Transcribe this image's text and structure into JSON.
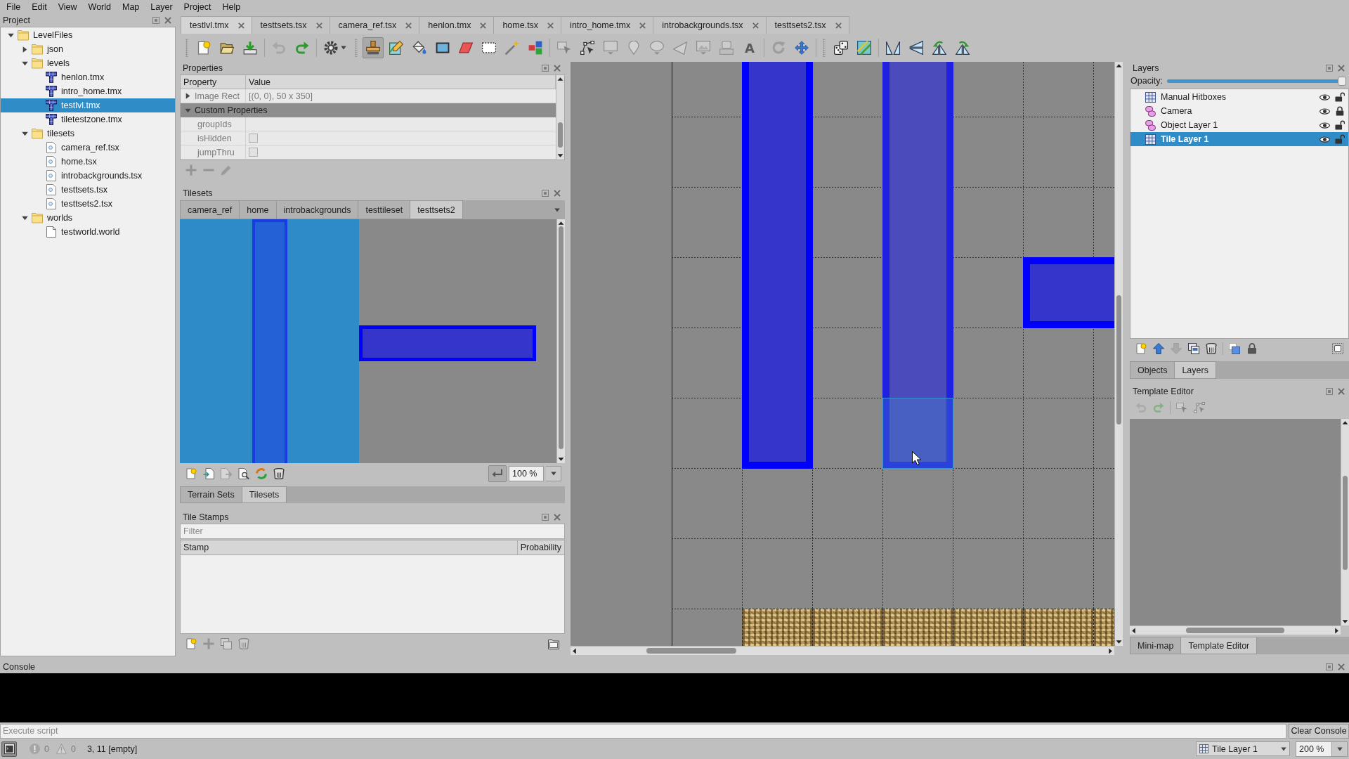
{
  "menu": [
    "File",
    "Edit",
    "View",
    "World",
    "Map",
    "Layer",
    "Project",
    "Help"
  ],
  "project": {
    "title": "Project",
    "tree": [
      {
        "label": "LevelFiles",
        "kind": "folder",
        "expanded": true,
        "selected": false,
        "children": [
          {
            "label": "json",
            "kind": "folder",
            "expanded": false,
            "selected": false
          },
          {
            "label": "levels",
            "kind": "folder",
            "expanded": true,
            "selected": false,
            "children": [
              {
                "label": "henlon.tmx",
                "kind": "map",
                "selected": false
              },
              {
                "label": "intro_home.tmx",
                "kind": "map",
                "selected": false
              },
              {
                "label": "testlvl.tmx",
                "kind": "map",
                "selected": true
              },
              {
                "label": "tiletestzone.tmx",
                "kind": "map",
                "selected": false
              }
            ]
          },
          {
            "label": "tilesets",
            "kind": "folder",
            "expanded": true,
            "selected": false,
            "children": [
              {
                "label": "camera_ref.tsx",
                "kind": "tileset",
                "selected": false
              },
              {
                "label": "home.tsx",
                "kind": "tileset",
                "selected": false
              },
              {
                "label": "introbackgrounds.tsx",
                "kind": "tileset",
                "selected": false
              },
              {
                "label": "testtsets.tsx",
                "kind": "tileset",
                "selected": false
              },
              {
                "label": "testtsets2.tsx",
                "kind": "tileset",
                "selected": false
              }
            ]
          },
          {
            "label": "worlds",
            "kind": "folder",
            "expanded": true,
            "selected": false,
            "children": [
              {
                "label": "testworld.world",
                "kind": "world",
                "selected": false
              }
            ]
          }
        ]
      }
    ]
  },
  "document_tabs": [
    {
      "label": "testlvl.tmx",
      "selected": true
    },
    {
      "label": "testtsets.tsx",
      "selected": false
    },
    {
      "label": "camera_ref.tsx",
      "selected": false
    },
    {
      "label": "henlon.tmx",
      "selected": false
    },
    {
      "label": "home.tsx",
      "selected": false
    },
    {
      "label": "intro_home.tmx",
      "selected": false
    },
    {
      "label": "introbackgrounds.tsx",
      "selected": false
    },
    {
      "label": "testtsets2.tsx",
      "selected": false
    }
  ],
  "toolbars": [
    {
      "groups": [
        [
          {
            "kind": "new",
            "selected": false,
            "disabled": false
          },
          {
            "kind": "open",
            "selected": false,
            "disabled": false
          },
          {
            "kind": "save",
            "selected": false,
            "disabled": false
          }
        ],
        [
          {
            "kind": "undo",
            "selected": false,
            "disabled": true
          },
          {
            "kind": "redo",
            "selected": false,
            "disabled": false
          }
        ],
        [
          {
            "kind": "commands",
            "selected": false,
            "disabled": false
          }
        ]
      ]
    },
    {
      "groups": [
        [
          {
            "kind": "stamp",
            "selected": true,
            "disabled": false
          },
          {
            "kind": "terrain",
            "selected": false,
            "disabled": false
          },
          {
            "kind": "bucket",
            "selected": false,
            "disabled": false
          },
          {
            "kind": "shape-fill",
            "selected": false,
            "disabled": false
          },
          {
            "kind": "eraser",
            "selected": false,
            "disabled": false
          },
          {
            "kind": "rect-select",
            "selected": false,
            "disabled": false
          },
          {
            "kind": "magic-wand",
            "selected": false,
            "disabled": false
          },
          {
            "kind": "select-same",
            "selected": false,
            "disabled": false
          }
        ],
        [
          {
            "kind": "object-select",
            "selected": false,
            "disabled": true
          },
          {
            "kind": "edit-polygons",
            "selected": false,
            "disabled": false
          },
          {
            "kind": "insert-rect",
            "selected": false,
            "disabled": true
          },
          {
            "kind": "insert-point",
            "selected": false,
            "disabled": true
          },
          {
            "kind": "insert-ellipse",
            "selected": false,
            "disabled": true
          },
          {
            "kind": "insert-polygon",
            "selected": false,
            "disabled": true
          },
          {
            "kind": "insert-tile",
            "selected": false,
            "disabled": true
          },
          {
            "kind": "insert-template",
            "selected": false,
            "disabled": true
          },
          {
            "kind": "insert-text",
            "glyph": "A",
            "selected": false,
            "disabled": false
          }
        ],
        [
          {
            "kind": "replace-tile",
            "selected": false,
            "disabled": true
          },
          {
            "kind": "transform",
            "selected": false,
            "disabled": false
          }
        ]
      ]
    },
    {
      "groups": [
        [
          {
            "kind": "random",
            "selected": false,
            "disabled": false
          },
          {
            "kind": "wang",
            "selected": false,
            "disabled": false
          }
        ],
        [
          {
            "kind": "flip-horizontal",
            "selected": false,
            "disabled": false
          },
          {
            "kind": "flip-vertical",
            "selected": false,
            "disabled": false
          },
          {
            "kind": "rotate-left",
            "selected": false,
            "disabled": false
          },
          {
            "kind": "rotate-right",
            "selected": false,
            "disabled": false
          }
        ]
      ]
    }
  ],
  "properties": {
    "title": "Properties",
    "columns": [
      "Property",
      "Value"
    ],
    "image_rect": {
      "name": "Image Rect",
      "value": "[(0, 0), 50 x 350]",
      "expanded": false
    },
    "custom_properties": {
      "name": "Custom Properties",
      "expanded": true,
      "rows": [
        {
          "kind": "text",
          "name": "groupIds"
        },
        {
          "kind": "checkbox",
          "name": "isHidden",
          "checked": false
        },
        {
          "kind": "checkbox",
          "name": "jumpThru",
          "checked": false
        }
      ]
    },
    "tools": [
      [
        {
          "kind": "add",
          "disabled": true
        },
        {
          "kind": "remove",
          "disabled": true
        },
        {
          "kind": "edit",
          "disabled": true
        }
      ]
    ]
  },
  "tilesets": {
    "title": "Tilesets",
    "tabs": [
      {
        "label": "camera_ref",
        "selected": false
      },
      {
        "label": "home",
        "selected": false
      },
      {
        "label": "introbackgrounds",
        "selected": false
      },
      {
        "label": "testtileset",
        "selected": false
      },
      {
        "label": "testtsets2",
        "selected": true
      }
    ],
    "tiles": [
      {
        "kind": "vertical-bar",
        "selected": true
      },
      {
        "kind": "horizontal-bar",
        "selected": false
      }
    ],
    "tools": [
      [
        {
          "kind": "new",
          "disabled": false
        },
        {
          "kind": "import",
          "disabled": false
        },
        {
          "kind": "export",
          "disabled": true
        },
        {
          "kind": "tileset-properties",
          "disabled": false
        },
        {
          "kind": "swap",
          "disabled": false
        },
        {
          "kind": "delete",
          "disabled": false
        }
      ]
    ],
    "wrap": {
      "on": true
    },
    "zoom": "100 %",
    "bottom_tabs": [
      {
        "label": "Terrain Sets",
        "selected": false
      },
      {
        "label": "Tilesets",
        "selected": true
      }
    ]
  },
  "tile_stamps": {
    "title": "Tile Stamps",
    "filter": {
      "placeholder": "Filter"
    },
    "columns": [
      "Stamp",
      "Probability"
    ],
    "tools": [
      [
        {
          "kind": "new",
          "disabled": false
        },
        {
          "kind": "add",
          "disabled": true
        },
        {
          "kind": "duplicate-stamp",
          "disabled": true
        },
        {
          "kind": "delete",
          "disabled": true
        }
      ],
      [
        {
          "kind": "open-folder",
          "disabled": false
        }
      ]
    ]
  },
  "layers": {
    "title": "Layers",
    "opacity": {
      "label": "Opacity:",
      "level": 1
    },
    "items": [
      {
        "name": "Manual Hitboxes",
        "kind": "tile",
        "visible": true,
        "locked": false,
        "selected": false
      },
      {
        "name": "Camera",
        "kind": "object",
        "visible": true,
        "locked": true,
        "selected": false
      },
      {
        "name": "Object Layer 1",
        "kind": "object",
        "visible": true,
        "locked": false,
        "selected": false
      },
      {
        "name": "Tile Layer 1",
        "kind": "tile",
        "visible": true,
        "locked": false,
        "selected": true
      }
    ],
    "tools": [
      [
        {
          "kind": "new",
          "disabled": false
        },
        {
          "kind": "raise",
          "disabled": false
        },
        {
          "kind": "lower",
          "disabled": true
        },
        {
          "kind": "duplicate",
          "disabled": false
        },
        {
          "kind": "delete",
          "disabled": false
        }
      ],
      [
        {
          "kind": "toggle-others",
          "disabled": false
        },
        {
          "kind": "lock",
          "disabled": false
        }
      ],
      [
        {
          "kind": "highlight",
          "disabled": false
        }
      ]
    ],
    "tabs": [
      {
        "label": "Objects",
        "selected": false
      },
      {
        "label": "Layers",
        "selected": true
      }
    ]
  },
  "template_editor": {
    "title": "Template Editor",
    "tools": [
      [
        {
          "kind": "undo",
          "disabled": true
        },
        {
          "kind": "redo",
          "disabled": true
        }
      ],
      [
        {
          "kind": "object-select",
          "disabled": true
        },
        {
          "kind": "edit-polygons",
          "disabled": true
        }
      ]
    ],
    "tabs": [
      {
        "label": "Mini-map",
        "selected": false
      },
      {
        "label": "Template Editor",
        "selected": true
      }
    ]
  },
  "console": {
    "title": "Console",
    "input": {
      "placeholder": "Execute script"
    },
    "clear_button": "Clear Console"
  },
  "status_bar": {
    "console_toggle": {
      "on": true
    },
    "errors": "0",
    "warnings": "0",
    "position": "3, 11 [empty]",
    "layer": "Tile Layer 1",
    "zoom": "200 %"
  }
}
